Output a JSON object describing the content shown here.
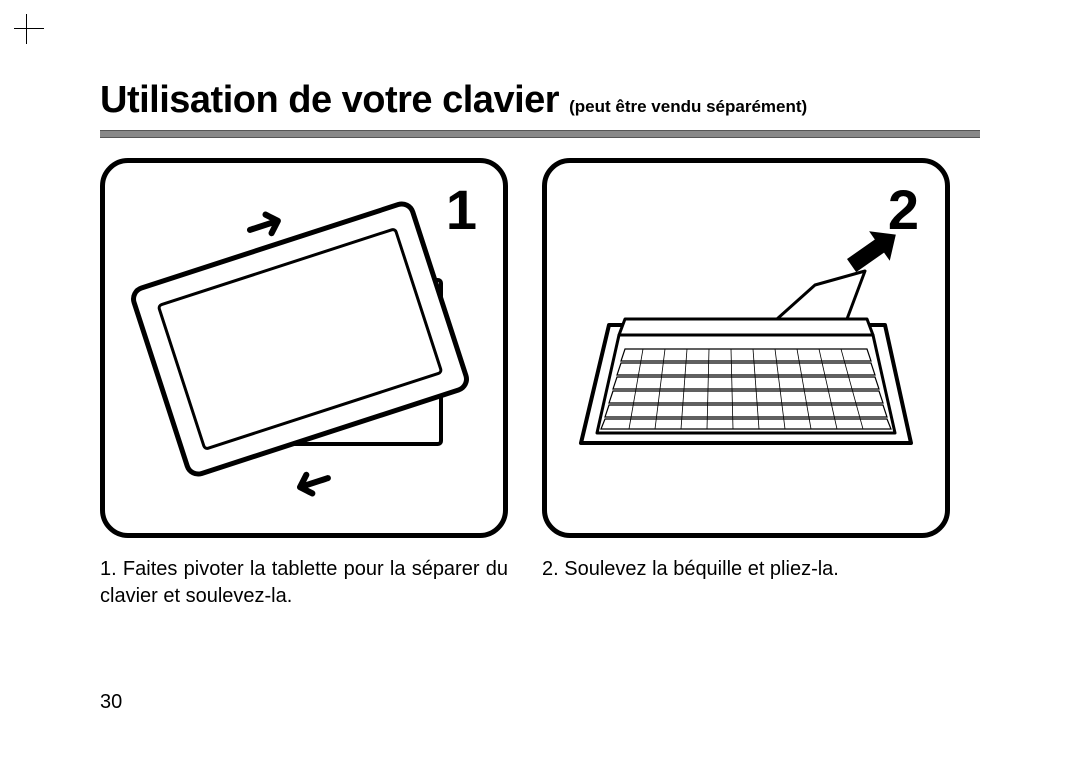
{
  "heading": {
    "title": "Utilisation de votre clavier",
    "subtitle": "(peut être vendu séparément)"
  },
  "steps": [
    {
      "num": "1",
      "caption": "1. Faites pivoter la tablette pour la séparer du clavier et soulevez-la."
    },
    {
      "num": "2",
      "caption": "2. Soulevez la béquille et pliez-la."
    }
  ],
  "page_number": "30"
}
